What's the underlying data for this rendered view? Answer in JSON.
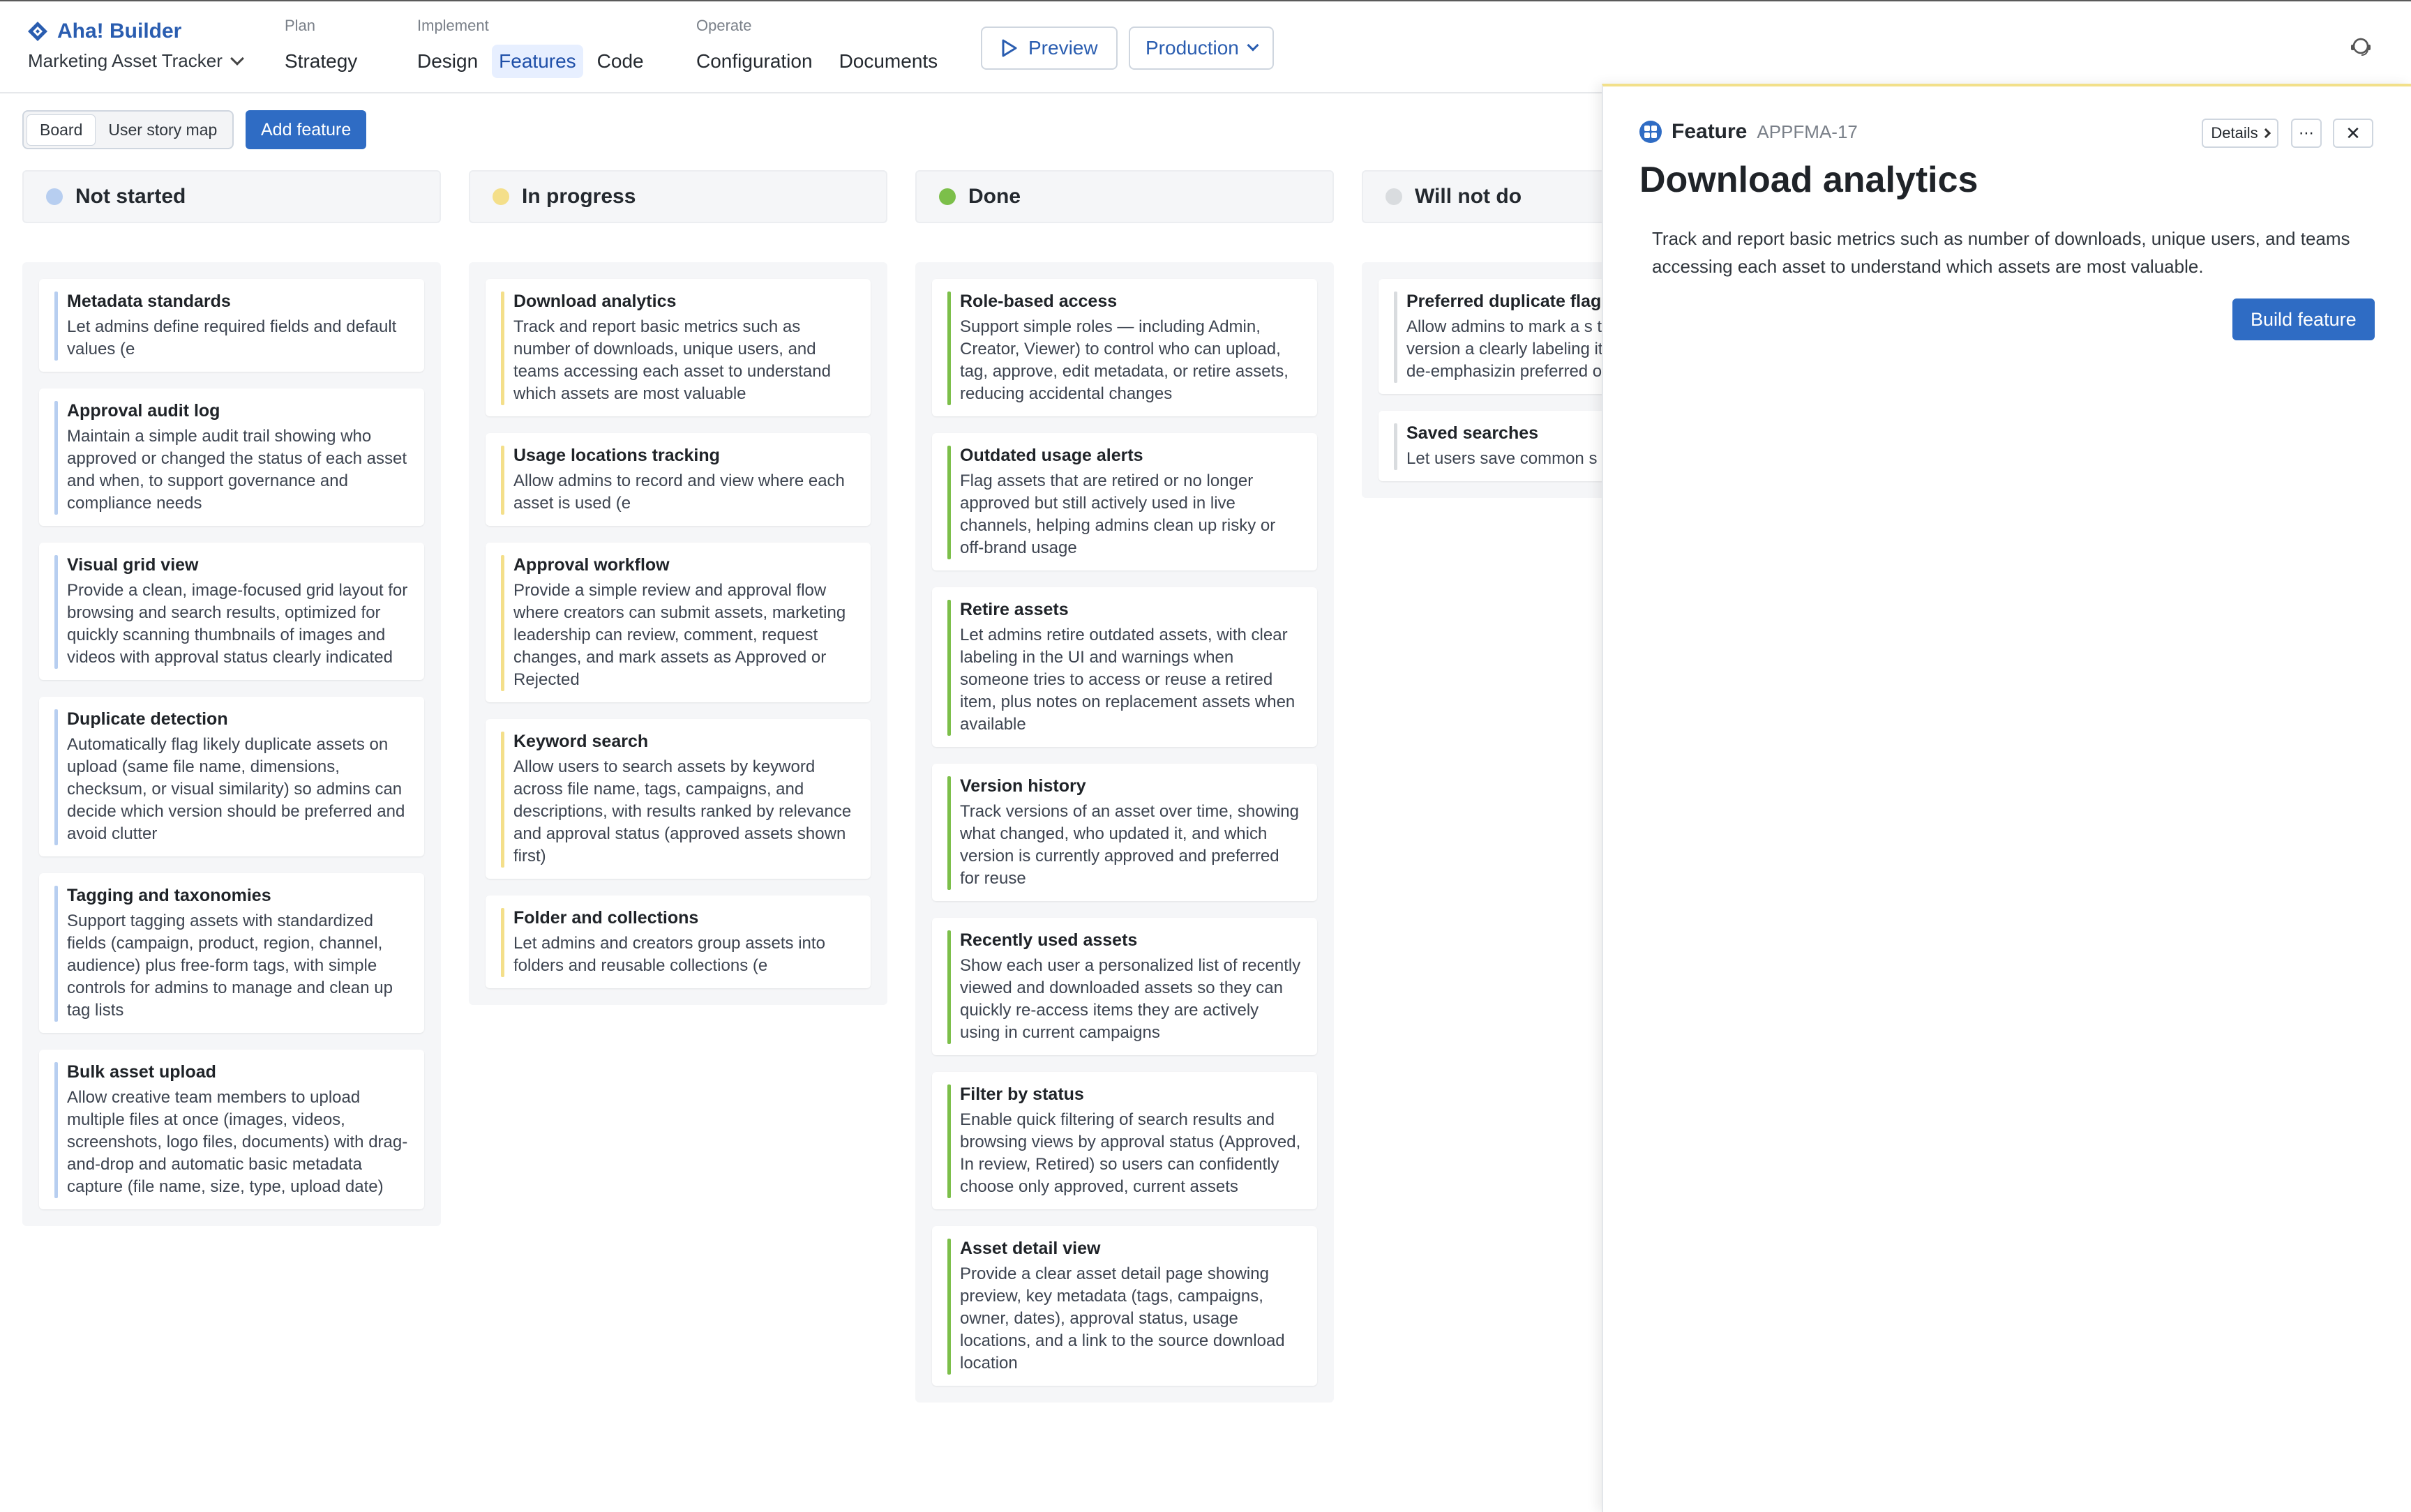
{
  "brand": {
    "name": "Aha! Builder",
    "workspace": "Marketing Asset Tracker"
  },
  "nav": {
    "groups": [
      {
        "label": "Plan",
        "items": [
          "Strategy"
        ]
      },
      {
        "label": "Implement",
        "items": [
          "Design",
          "Features",
          "Code"
        ]
      },
      {
        "label": "Operate",
        "items": [
          "Configuration",
          "Documents"
        ]
      }
    ],
    "active": "Features",
    "preview_label": "Preview",
    "env_label": "Production"
  },
  "toolbar": {
    "views": [
      "Board",
      "User story map"
    ],
    "selected_view": "Board",
    "add_label": "Add feature"
  },
  "colors": {
    "accent": "#2f6cc4",
    "not_started": "#b7cef0",
    "in_progress": "#f4df8a",
    "done": "#7cbf4a",
    "will_not_do": "#d9dcdf"
  },
  "columns": [
    {
      "title": "Not started",
      "cards": [
        {
          "title": "Metadata standards",
          "desc": "Let admins define required fields and default values (e"
        },
        {
          "title": "Approval audit log",
          "desc": "Maintain a simple audit trail showing who approved or changed the status of each asset and when, to support governance and compliance needs"
        },
        {
          "title": "Visual grid view",
          "desc": "Provide a clean, image-focused grid layout for browsing and search results, optimized for quickly scanning thumbnails of images and videos with approval status clearly indicated"
        },
        {
          "title": "Duplicate detection",
          "desc": "Automatically flag likely duplicate assets on upload (same file name, dimensions, checksum, or visual similarity) so admins can decide which version should be preferred and avoid clutter"
        },
        {
          "title": "Tagging and taxonomies",
          "desc": "Support tagging assets with standardized fields (campaign, product, region, channel, audience) plus free-form tags, with simple controls for admins to manage and clean up tag lists"
        },
        {
          "title": "Bulk asset upload",
          "desc": "Allow creative team members to upload multiple files at once (images, videos, screenshots, logo files, documents) with drag-and-drop and automatic basic metadata capture (file name, size, type, upload date)"
        }
      ]
    },
    {
      "title": "In progress",
      "cards": [
        {
          "title": "Download analytics",
          "desc": "Track and report basic metrics such as number of downloads, unique users, and teams accessing each asset to understand which assets are most valuable"
        },
        {
          "title": "Usage locations tracking",
          "desc": "Allow admins to record and view where each asset is used (e"
        },
        {
          "title": "Approval workflow",
          "desc": "Provide a simple review and approval flow where creators can submit assets, marketing leadership can review, comment, request changes, and mark assets as Approved or Rejected"
        },
        {
          "title": "Keyword search",
          "desc": "Allow users to search assets by keyword across file name, tags, campaigns, and descriptions, with results ranked by relevance and approval status (approved assets shown first)"
        },
        {
          "title": "Folder and collections",
          "desc": "Let admins and creators group assets into folders and reusable collections (e"
        }
      ]
    },
    {
      "title": "Done",
      "cards": [
        {
          "title": "Role-based access",
          "desc": "Support simple roles — including Admin, Creator, Viewer) to control who can upload, tag, approve, edit metadata, or retire assets, reducing accidental changes"
        },
        {
          "title": "Outdated usage alerts",
          "desc": "Flag assets that are retired or no longer approved but still actively used in live channels, helping admins clean up risky or off-brand usage"
        },
        {
          "title": "Retire assets",
          "desc": "Let admins retire outdated assets, with clear labeling in the UI and warnings when someone tries to access or reuse a retired item, plus notes on replacement assets when available"
        },
        {
          "title": "Version history",
          "desc": "Track versions of an asset over time, showing what changed, who updated it, and which version is currently approved and preferred for reuse"
        },
        {
          "title": "Recently used assets",
          "desc": "Show each user a personalized list of recently viewed and downloaded assets so they can quickly re-access items they are actively using in current campaigns"
        },
        {
          "title": "Filter by status",
          "desc": "Enable quick filtering of search results and browsing views by approval status (Approved, In review, Retired) so users can confidently choose only approved, current assets"
        },
        {
          "title": "Asset detail view",
          "desc": "Provide a clear asset detail page showing preview, key metadata (tags, campaigns, owner, dates), approval status, usage locations, and a link to the source download location"
        }
      ]
    },
    {
      "title": "Will not do",
      "cards": [
        {
          "title": "Preferred duplicate flag",
          "desc": "Allow admins to mark a s the \"preferred\" version a clearly labeling it in searc views and de-emphasizin preferred ones"
        },
        {
          "title": "Saved searches",
          "desc": "Let users save common s combinations (e"
        }
      ]
    }
  ],
  "drawer": {
    "type_label": "Feature",
    "ref": "APPFMA-17",
    "details_label": "Details",
    "more_label": "⋯",
    "close_label": "✕",
    "title": "Download analytics",
    "description": "Track and report basic metrics such as number of downloads, unique users, and teams accessing each asset to understand which assets are most valuable.",
    "build_label": "Build feature"
  }
}
